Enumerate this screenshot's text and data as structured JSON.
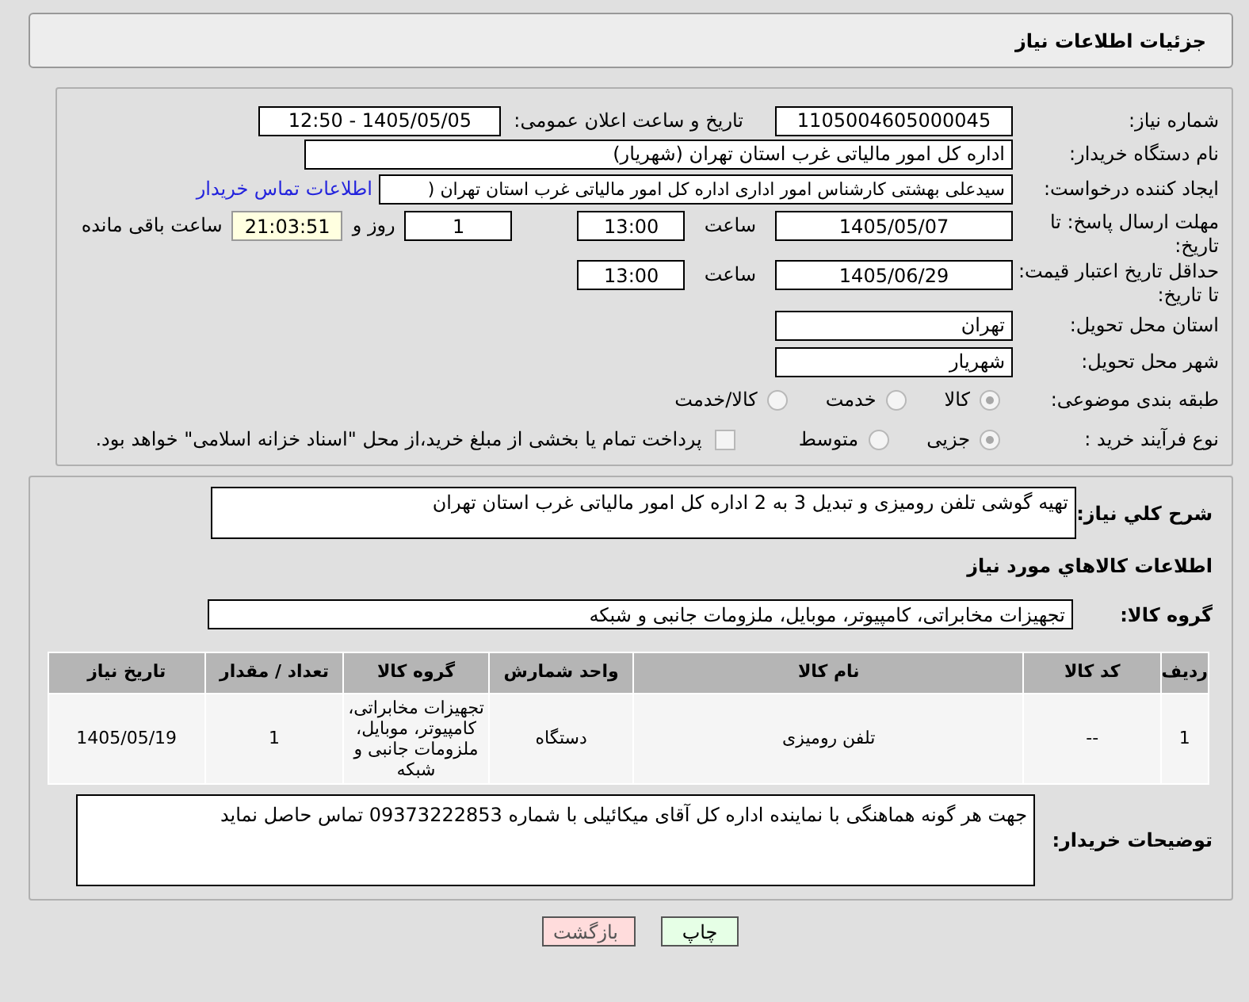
{
  "header": {
    "title": "جزئیات اطلاعات نیاز"
  },
  "need_number": {
    "label": "شماره نیاز:",
    "value": "1105004605000045"
  },
  "announce": {
    "label": "تاریخ و ساعت اعلان عمومی:",
    "value": "1405/05/05 - 12:50"
  },
  "buyer_org": {
    "label": "نام دستگاه خریدار:",
    "value": "اداره کل امور مالیاتی غرب استان تهران (شهریار)"
  },
  "creator": {
    "label": "ایجاد کننده درخواست:",
    "value": "سیدعلی بهشتی کارشناس امور اداری اداره کل امور مالیاتی غرب استان تهران (",
    "link": "اطلاعات تماس خریدار"
  },
  "deadline": {
    "label": "مهلت ارسال پاسخ: تا تاریخ:",
    "date": "1405/05/07",
    "time_label": "ساعت",
    "time": "13:00",
    "days": "1",
    "days_label": "روز و",
    "remaining": "21:03:51",
    "remaining_label": "ساعت باقی مانده"
  },
  "validity": {
    "label": "حداقل تاریخ اعتبار قیمت: تا تاریخ:",
    "date": "1405/06/29",
    "time_label": "ساعت",
    "time": "13:00"
  },
  "province": {
    "label": "استان محل تحویل:",
    "value": "تهران"
  },
  "city": {
    "label": "شهر محل تحویل:",
    "value": "شهریار"
  },
  "category": {
    "label": "طبقه بندی موضوعی:",
    "options": [
      {
        "label": "کالا",
        "selected": true
      },
      {
        "label": "خدمت",
        "selected": false
      },
      {
        "label": "کالا/خدمت",
        "selected": false
      }
    ]
  },
  "process": {
    "label": "نوع فرآیند خرید :",
    "options": [
      {
        "label": "جزیی",
        "selected": true
      },
      {
        "label": "متوسط",
        "selected": false
      }
    ],
    "treasury": {
      "label": "پرداخت تمام یا بخشی از مبلغ خرید،از محل \"اسناد خزانه اسلامی\" خواهد بود.",
      "checked": false
    }
  },
  "description": {
    "label": "شرح کلي نياز:",
    "value": "تهیه گوشی تلفن رومیزی و تبدیل 3 به 2 اداره کل امور مالیاتی غرب استان تهران"
  },
  "goods_title": "اطلاعات کالاهاي مورد نياز",
  "goods_group": {
    "label": "گروه کالا:",
    "value": "تجهیزات مخابراتی، کامپیوتر، موبایل، ملزومات جانبی و شبکه"
  },
  "table": {
    "columns": [
      "ردیف",
      "کد کالا",
      "نام کالا",
      "واحد شمارش",
      "گروه کالا",
      "تعداد / مقدار",
      "تاریخ نیاز"
    ],
    "rows": [
      [
        "1",
        "--",
        "تلفن رومیزی",
        "دستگاه",
        "تجهیزات مخابراتی، کامپیوتر، موبایل، ملزومات جانبی و شبکه",
        "1",
        "1405/05/19"
      ]
    ]
  },
  "buyer_notes": {
    "label": "توضیحات خریدار:",
    "value": "جهت هر گونه هماهنگی با نماینده اداره کل آقای میکائیلی با شماره 09373222853 تماس حاصل نماید"
  },
  "buttons": [
    {
      "label": "چاپ",
      "kind": "print"
    },
    {
      "label": "بازگشت",
      "kind": "back"
    }
  ]
}
